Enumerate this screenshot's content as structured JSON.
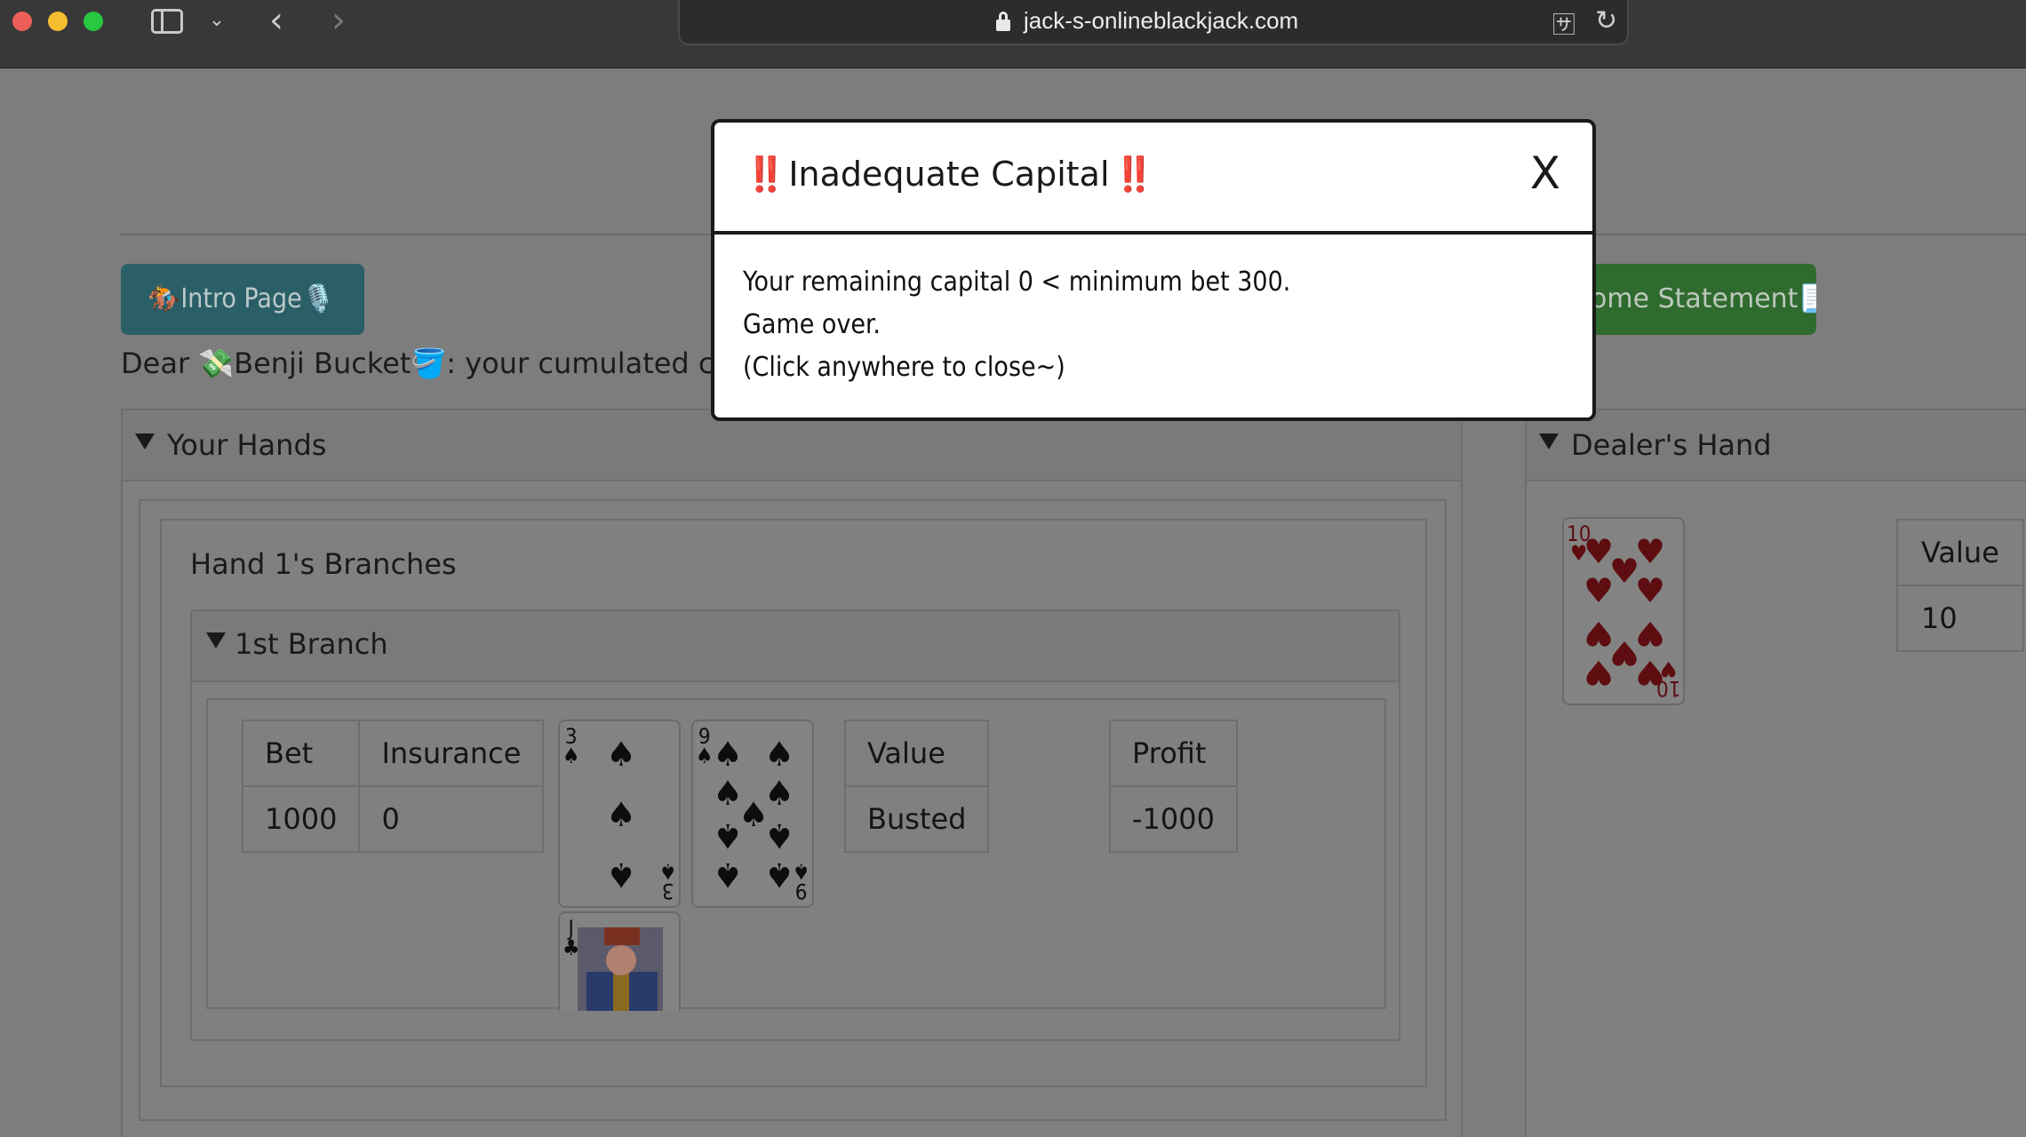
{
  "browser": {
    "url": "jack-s-onlineblackjack.com",
    "icons": [
      "sidebar-icon",
      "chevron-down-icon",
      "back-icon",
      "forward-icon",
      "lock-icon",
      "translate-icon",
      "reload-icon"
    ]
  },
  "nav": {
    "intro_label": "🏇Intro Page🎙️",
    "income_label": "ome Statement📃"
  },
  "greeting": "Dear 💸Benji Bucket🪣: your cumulated capital",
  "your_hands": {
    "title": "Your Hands",
    "hand_title": "Hand 1's Branches",
    "branch_title": "1st Branch",
    "bet_header": "Bet",
    "insurance_header": "Insurance",
    "bet": "1000",
    "insurance": "0",
    "value_header": "Value",
    "value": "Busted",
    "profit_header": "Profit",
    "profit": "-1000",
    "cards": [
      {
        "rank": "3",
        "suit": "♠"
      },
      {
        "rank": "9",
        "suit": "♠"
      },
      {
        "rank": "J",
        "suit": "♣"
      }
    ]
  },
  "dealer_hand": {
    "title": "Dealer's Hand",
    "value_header": "Value",
    "value": "10",
    "cards": [
      {
        "rank": "10",
        "suit": "♥"
      }
    ]
  },
  "modal": {
    "bang": "‼️",
    "title": "Inadequate Capital",
    "close_label": "X",
    "line1": "Your remaining capital 0 < minimum bet 300.",
    "line2": "Game over.",
    "line3": "(Click anywhere to close~)"
  },
  "colors": {
    "overlay": "#7d7d7d",
    "intro_button": "#2a5f68",
    "income_button": "#2f6b2f",
    "alert_red": "#d21d1d",
    "loss_red": "#7a0d0d"
  }
}
